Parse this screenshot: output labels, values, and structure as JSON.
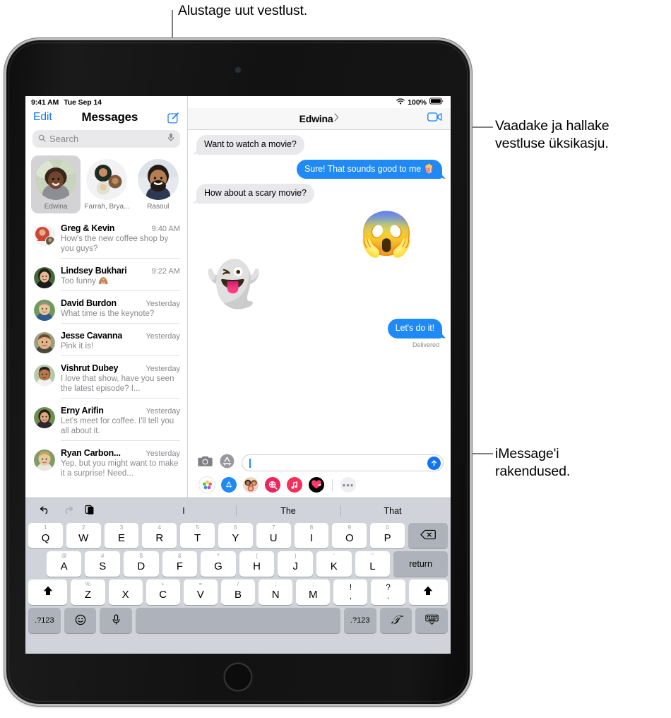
{
  "callouts": {
    "new_conversation": "Alustage uut vestlust.",
    "conversation_details": "Vaadake ja hallake\nvestluse üksikasju.",
    "imessage_apps": "iMessage'i\nrakendused."
  },
  "status_bar": {
    "time": "9:41 AM",
    "date": "Tue Sep 14",
    "wifi_icon": "wifi-icon",
    "battery_percent": "100%",
    "battery_icon": "battery-full-icon"
  },
  "sidebar": {
    "edit_label": "Edit",
    "title": "Messages",
    "compose_icon": "compose-icon",
    "search": {
      "placeholder": "Search",
      "search_icon": "search-icon",
      "dictation_icon": "microphone-icon"
    },
    "pinned": [
      {
        "label": "Edwina",
        "selected": true,
        "type": "single"
      },
      {
        "label": "Farrah, Brya...",
        "selected": false,
        "type": "group"
      },
      {
        "label": "Rasoul",
        "selected": false,
        "type": "single"
      }
    ],
    "conversations": [
      {
        "name": "Greg & Kevin",
        "time": "9:40 AM",
        "preview": "How's the new coffee shop by you guys?"
      },
      {
        "name": "Lindsey Bukhari",
        "time": "9:22 AM",
        "preview": "Too funny 🙈"
      },
      {
        "name": "David Burdon",
        "time": "Yesterday",
        "preview": "What time is the keynote?"
      },
      {
        "name": "Jesse Cavanna",
        "time": "Yesterday",
        "preview": "Pink it is!"
      },
      {
        "name": "Vishrut Dubey",
        "time": "Yesterday",
        "preview": "I love that show, have you seen the latest episode? I..."
      },
      {
        "name": "Erny Arifin",
        "time": "Yesterday",
        "preview": "Let's meet for coffee. I'll tell you all about it."
      },
      {
        "name": "Ryan Carbon...",
        "time": "Yesterday",
        "preview": "Yep, but you might want to make it a surprise! Need..."
      }
    ]
  },
  "conversation": {
    "title": "Edwina",
    "disclosure_icon": "chevron-right-icon",
    "facetime_icon": "video-camera-icon",
    "messages": [
      {
        "side": "them",
        "kind": "text",
        "text": "Want to watch a movie?"
      },
      {
        "side": "me",
        "kind": "text",
        "text": "Sure! That sounds good to me 🍿"
      },
      {
        "side": "them",
        "kind": "text",
        "text": "How about a scary movie?"
      },
      {
        "side": "me",
        "kind": "sticker",
        "text": "😱"
      },
      {
        "side": "them",
        "kind": "sticker",
        "text": "👻"
      },
      {
        "side": "me",
        "kind": "text",
        "text": "Let's do it!"
      }
    ],
    "delivered_label": "Delivered"
  },
  "input_bar": {
    "camera_icon": "camera-icon",
    "apps_icon": "app-store-icon",
    "field_value": "",
    "send_icon": "send-arrow-up-icon"
  },
  "app_drawer": {
    "items": [
      {
        "name": "photos-app-icon",
        "glyph": "❁",
        "bg": "#ffffff",
        "color": "#f04f4f"
      },
      {
        "name": "app-store-app-icon",
        "glyph": "A",
        "bg": "#1f8af5",
        "color": "#ffffff"
      },
      {
        "name": "memoji-stickers-icon",
        "glyph": "🧑‍🎤",
        "bg": "#f3e4d4",
        "color": "#000000"
      },
      {
        "name": "image-search-icon",
        "glyph": "🔍",
        "bg": "#f0245c",
        "color": "#ffffff"
      },
      {
        "name": "music-app-icon",
        "glyph": "♫",
        "bg": "#f5315b",
        "color": "#ffffff"
      },
      {
        "name": "digital-touch-icon",
        "glyph": "💗",
        "bg": "#000000",
        "color": "#ff3b6b"
      }
    ],
    "more_label": "•••"
  },
  "keyboard": {
    "tools": [
      {
        "name": "undo-icon",
        "glyph": "↺",
        "dim": false
      },
      {
        "name": "redo-icon",
        "glyph": "↻",
        "dim": true
      },
      {
        "name": "paste-icon",
        "glyph": "⧉",
        "dim": false
      }
    ],
    "suggestions": [
      "I",
      "The",
      "That"
    ],
    "row1": [
      {
        "main": "Q",
        "alt": "1"
      },
      {
        "main": "W",
        "alt": "2"
      },
      {
        "main": "E",
        "alt": "3"
      },
      {
        "main": "R",
        "alt": "4"
      },
      {
        "main": "T",
        "alt": "5"
      },
      {
        "main": "Y",
        "alt": "6"
      },
      {
        "main": "U",
        "alt": "7"
      },
      {
        "main": "I",
        "alt": "8"
      },
      {
        "main": "O",
        "alt": "9"
      },
      {
        "main": "P",
        "alt": "0"
      }
    ],
    "backspace_icon": "backspace-icon",
    "row2": [
      {
        "main": "A",
        "alt": "@"
      },
      {
        "main": "S",
        "alt": "#"
      },
      {
        "main": "D",
        "alt": "$"
      },
      {
        "main": "F",
        "alt": "&"
      },
      {
        "main": "G",
        "alt": "*"
      },
      {
        "main": "H",
        "alt": "("
      },
      {
        "main": "J",
        "alt": ")"
      },
      {
        "main": "K",
        "alt": "'"
      },
      {
        "main": "L",
        "alt": "\""
      }
    ],
    "return_label": "return",
    "row3": [
      {
        "main": "Z",
        "alt": "%"
      },
      {
        "main": "X",
        "alt": "-"
      },
      {
        "main": "C",
        "alt": "+"
      },
      {
        "main": "V",
        "alt": "="
      },
      {
        "main": "B",
        "alt": "/"
      },
      {
        "main": "N",
        "alt": ";"
      },
      {
        "main": "M",
        "alt": ":"
      }
    ],
    "punct1": {
      "top": "!",
      "bottom": ","
    },
    "punct2": {
      "top": "?",
      "bottom": "."
    },
    "shift_icon": "shift-arrow-icon",
    "numbers_label": ".?123",
    "emoji_icon": "emoji-smiley-icon",
    "dictation_icon": "microphone-icon",
    "handwriting_icon": "handwriting-pen-icon",
    "hide_keyboard_icon": "hide-keyboard-icon"
  }
}
